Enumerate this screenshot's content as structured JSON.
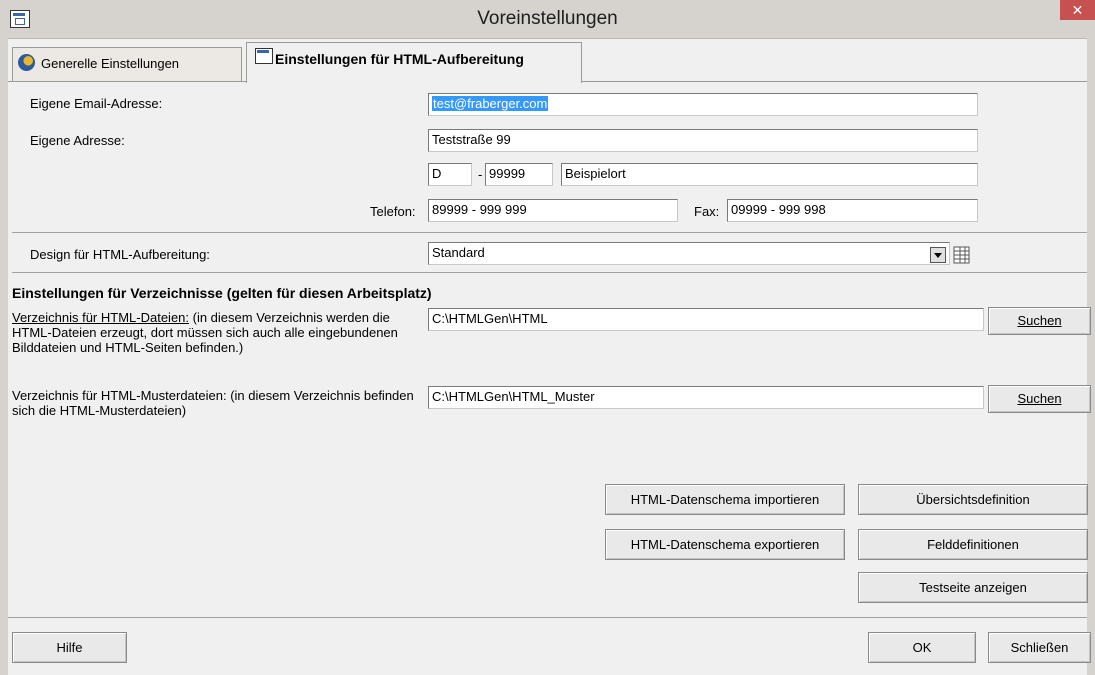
{
  "window": {
    "title": "Voreinstellungen",
    "close": "✕"
  },
  "tabs": [
    {
      "label": "Generelle Einstellungen"
    },
    {
      "label": "Einstellungen für HTML-Aufbereitung"
    }
  ],
  "form": {
    "email_label": "Eigene Email-Adresse:",
    "email_value": "test@fraberger.com",
    "address_label": "Eigene Adresse:",
    "street_value": "Teststraße 99",
    "country_value": "D",
    "zip_sep": "-",
    "zip_value": "99999",
    "city_value": "Beispielort",
    "phone_label": "Telefon:",
    "phone_value": "89999 - 999 999",
    "fax_label": "Fax:",
    "fax_value": "09999 - 999 998",
    "design_label": "Design für HTML-Aufbereitung:",
    "design_value": "Standard"
  },
  "directories": {
    "heading": "Einstellungen für Verzeichnisse (gelten für diesen Arbeitsplatz)",
    "html_files_label_underlined": "Verzeichnis für HTML-Dateien:",
    "html_files_label_rest": " (in diesem Verzeichnis werden die HTML-Dateien erzeugt, dort müssen sich auch alle eingebundenen Bilddateien und HTML-Seiten befinden.)",
    "html_files_value": "C:\\HTMLGen\\HTML",
    "template_label": "Verzeichnis für HTML-Musterdateien: (in diesem Verzeichnis befinden sich die HTML-Musterdateien)",
    "template_value": "C:\\HTMLGen\\HTML_Muster",
    "search_button": "Suchen"
  },
  "buttons": {
    "import_schema": "HTML-Datenschema importieren",
    "export_schema": "HTML-Datenschema exportieren",
    "overview_def": "Übersichtsdefinition",
    "field_defs": "Felddefinitionen",
    "show_testpage": "Testseite anzeigen",
    "help": "Hilfe",
    "ok": "OK",
    "close": "Schließen"
  }
}
